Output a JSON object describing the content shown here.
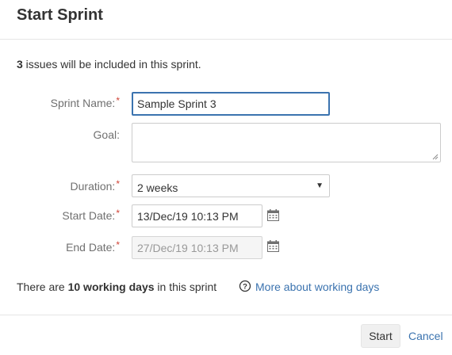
{
  "dialog": {
    "title": "Start Sprint"
  },
  "summary": {
    "count": "3",
    "text": " issues will be included in this sprint."
  },
  "form": {
    "sprint_name": {
      "label": "Sprint Name:",
      "required": "*",
      "value": "Sample Sprint 3"
    },
    "goal": {
      "label": "Goal:",
      "value": ""
    },
    "duration": {
      "label": "Duration:",
      "required": "*",
      "value": "2 weeks"
    },
    "start_date": {
      "label": "Start Date:",
      "required": "*",
      "value": "13/Dec/19 10:13 PM"
    },
    "end_date": {
      "label": "End Date:",
      "required": "*",
      "value": "27/Dec/19 10:13 PM"
    }
  },
  "working_days": {
    "prefix": "There are ",
    "bold": "10 working days",
    "suffix": " in this sprint",
    "link": "More about working days"
  },
  "footer": {
    "start_label": "Start",
    "cancel_label": "Cancel"
  },
  "icons": {
    "calendar": "calendar-icon",
    "help": "question-circle-icon",
    "dropdown": "caret-down-icon"
  },
  "colors": {
    "link": "#3b73af",
    "required": "#d04437",
    "focus_border": "#3b73af"
  }
}
